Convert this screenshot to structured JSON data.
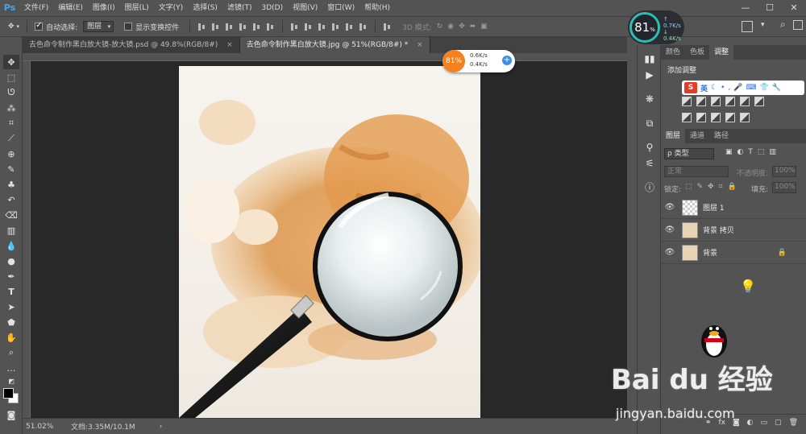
{
  "app": {
    "logo": "Ps"
  },
  "menu": [
    "文件(F)",
    "编辑(E)",
    "图像(I)",
    "图层(L)",
    "文字(Y)",
    "选择(S)",
    "滤镜(T)",
    "3D(D)",
    "视图(V)",
    "窗口(W)",
    "帮助(H)"
  ],
  "window_controls": {
    "minimize": "—",
    "maximize": "☐",
    "close": "✕"
  },
  "options": {
    "auto_select_label": "自动选择:",
    "auto_select_checked": true,
    "auto_select_target": "图层",
    "show_transform_label": "显示变换控件",
    "show_transform_checked": false,
    "mode_3d_label": "3D 模式:"
  },
  "tabs": [
    {
      "label": "去色命令制作黑白放大镜-放大镜.psd @ 49.8%(RGB/8#)",
      "close": "×",
      "active": false
    },
    {
      "label": "去色命令制作黑白放大镜.jpg @ 51%(RGB/8#) *",
      "close": "×",
      "active": true
    }
  ],
  "tools": [
    "move",
    "marquee",
    "lasso",
    "magic-wand",
    "crop",
    "eyedropper",
    "healing",
    "brush",
    "stamp",
    "history-brush",
    "eraser",
    "gradient",
    "blur",
    "dodge",
    "pen",
    "type",
    "path-select",
    "shape",
    "hand",
    "zoom",
    "more",
    "default-colors",
    "color-swatches",
    "quick-mask",
    "screen-mode"
  ],
  "status": {
    "zoom": "51.02%",
    "doc": "文档:3.35M/10.1M",
    "arrow": "›"
  },
  "net_meter_big": {
    "percent": "81",
    "percent_unit": "%",
    "up": "0.7",
    "down": "0.4",
    "unit": "K/s"
  },
  "net_meter_small": {
    "percent": "81%",
    "up": "0.6K/s",
    "down": "0.4K/s"
  },
  "panels": {
    "top_tabs": [
      "颜色",
      "色板",
      "调整"
    ],
    "top_active": 2,
    "add_adjustment_label": "添加调整",
    "layer_tabs": [
      "图层",
      "通道",
      "路径"
    ],
    "layer_active": 0,
    "kind_filter": "ρ 类型",
    "blend_mode": "正常",
    "opacity_label": "不透明度:",
    "opacity_value": "100%",
    "lock_label": "锁定:",
    "fill_label": "填充:",
    "fill_value": "100%",
    "layers": [
      {
        "name": "图层 1",
        "locked": false
      },
      {
        "name": "背景 拷贝",
        "locked": false
      },
      {
        "name": "背景",
        "locked": true
      }
    ]
  },
  "ime_bar": {
    "logo": "S",
    "lang": "英"
  },
  "watermark": {
    "brand": "Bai du 经验",
    "url": "jingyan.baidu.com"
  },
  "colors": {
    "ps_blue": "#3fa9f5",
    "ring_teal": "#2bc0b2",
    "meter_orange": "#f4811f",
    "sogou_red": "#e23c2a"
  }
}
